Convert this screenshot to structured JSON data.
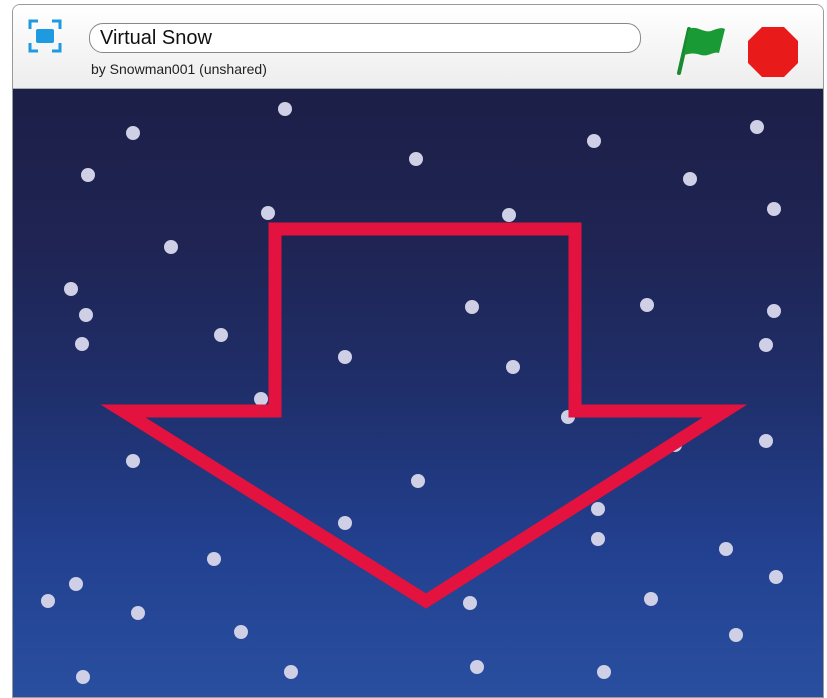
{
  "project": {
    "title": "Virtual Snow",
    "byline": "by Snowman001 (unshared)"
  },
  "icons": {
    "fullscreen": "fullscreen-icon",
    "green_flag": "green-flag-icon",
    "stop": "stop-sign-icon"
  },
  "colors": {
    "flag": "#1a9a35",
    "stop": "#e81a1a",
    "fullscreen": "#1e9be0",
    "snow": "#cfcfe6",
    "arrow_outline": "#e3123e"
  }
}
